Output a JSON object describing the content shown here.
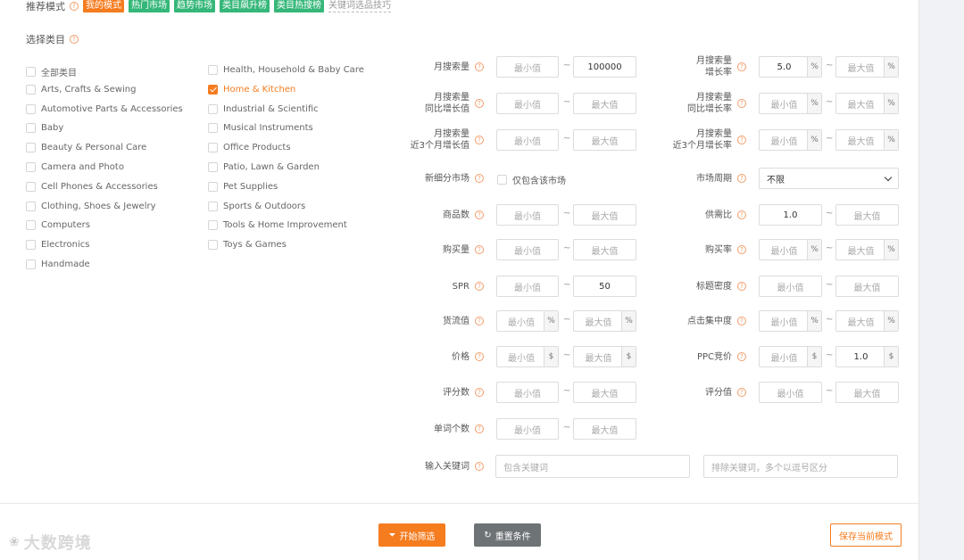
{
  "mode": {
    "label": "推荐模式",
    "tags": [
      "我的模式",
      "热门市场",
      "趋势市场",
      "类目飙升榜",
      "类目热搜榜"
    ],
    "tip_link": "关键词选品技巧"
  },
  "category": {
    "label": "选择类目",
    "col1": [
      "全部类目",
      "Arts, Crafts & Sewing",
      "Automotive Parts & Accessories",
      "Baby",
      "Beauty & Personal Care",
      "Camera and Photo",
      "Cell Phones & Accessories",
      "Clothing, Shoes & Jewelry",
      "Computers",
      "Electronics",
      "Handmade"
    ],
    "col2": [
      "Health, Household & Baby Care",
      "Home & Kitchen",
      "Industrial & Scientific",
      "Musical Instruments",
      "Office Products",
      "Patio, Lawn & Garden",
      "Pet Supplies",
      "Sports & Outdoors",
      "Tools & Home Improvement",
      "Toys & Games"
    ],
    "selected": "Home & Kitchen"
  },
  "filters": {
    "min_ph": "最小值",
    "max_ph": "最大值",
    "percent": "%",
    "dollar": "$",
    "left": [
      {
        "label": [
          "月搜索量"
        ],
        "min": "",
        "max": "100000"
      },
      {
        "label": [
          "月搜索量",
          "同比增长值"
        ],
        "min": "",
        "max": ""
      },
      {
        "label": [
          "月搜索量",
          "近3个月增长值"
        ],
        "min": "",
        "max": ""
      },
      {
        "label": [
          "新细分市场"
        ],
        "checkbox": "仅包含该市场"
      },
      {
        "label": [
          "商品数"
        ],
        "min": "",
        "max": ""
      },
      {
        "label": [
          "购买量"
        ],
        "min": "",
        "max": ""
      },
      {
        "label": [
          "SPR"
        ],
        "min": "",
        "max": "50"
      },
      {
        "label": [
          "货流值"
        ],
        "min": "",
        "max": "",
        "unit": "%"
      },
      {
        "label": [
          "价格"
        ],
        "min": "",
        "max": "",
        "unit": "$"
      },
      {
        "label": [
          "评分数"
        ],
        "min": "",
        "max": ""
      },
      {
        "label": [
          "单词个数"
        ],
        "min": "",
        "max": ""
      }
    ],
    "right": [
      {
        "label": [
          "月搜索量",
          "增长率"
        ],
        "min": "5.0",
        "max": "",
        "unit": "%"
      },
      {
        "label": [
          "月搜索量",
          "同比增长率"
        ],
        "min": "",
        "max": "",
        "unit": "%"
      },
      {
        "label": [
          "月搜索量",
          "近3个月增长率"
        ],
        "min": "",
        "max": "",
        "unit": "%"
      },
      {
        "label": [
          "市场周期"
        ],
        "select": "不限"
      },
      {
        "label": [
          "供需比"
        ],
        "min": "1.0",
        "max": ""
      },
      {
        "label": [
          "购买率"
        ],
        "min": "",
        "max": "",
        "unit": "%"
      },
      {
        "label": [
          "标题密度"
        ],
        "min": "",
        "max": ""
      },
      {
        "label": [
          "点击集中度"
        ],
        "min": "",
        "max": "",
        "unit": "%"
      },
      {
        "label": [
          "PPC竞价"
        ],
        "min": "",
        "max": "1.0",
        "unit": "$"
      },
      {
        "label": [
          "评分值"
        ],
        "min": "",
        "max": ""
      }
    ],
    "keyword_label": "输入关键词",
    "include_ph": "包含关键词",
    "exclude_ph": "排除关键词，多个以逗号区分"
  },
  "actions": {
    "start": "开始筛选",
    "reset": "重置条件",
    "save": "保存当前模式"
  },
  "brand": "大数跨境",
  "colors": {
    "accent": "#f57c1f",
    "green": "#35b779",
    "reset": "#6e7375"
  }
}
